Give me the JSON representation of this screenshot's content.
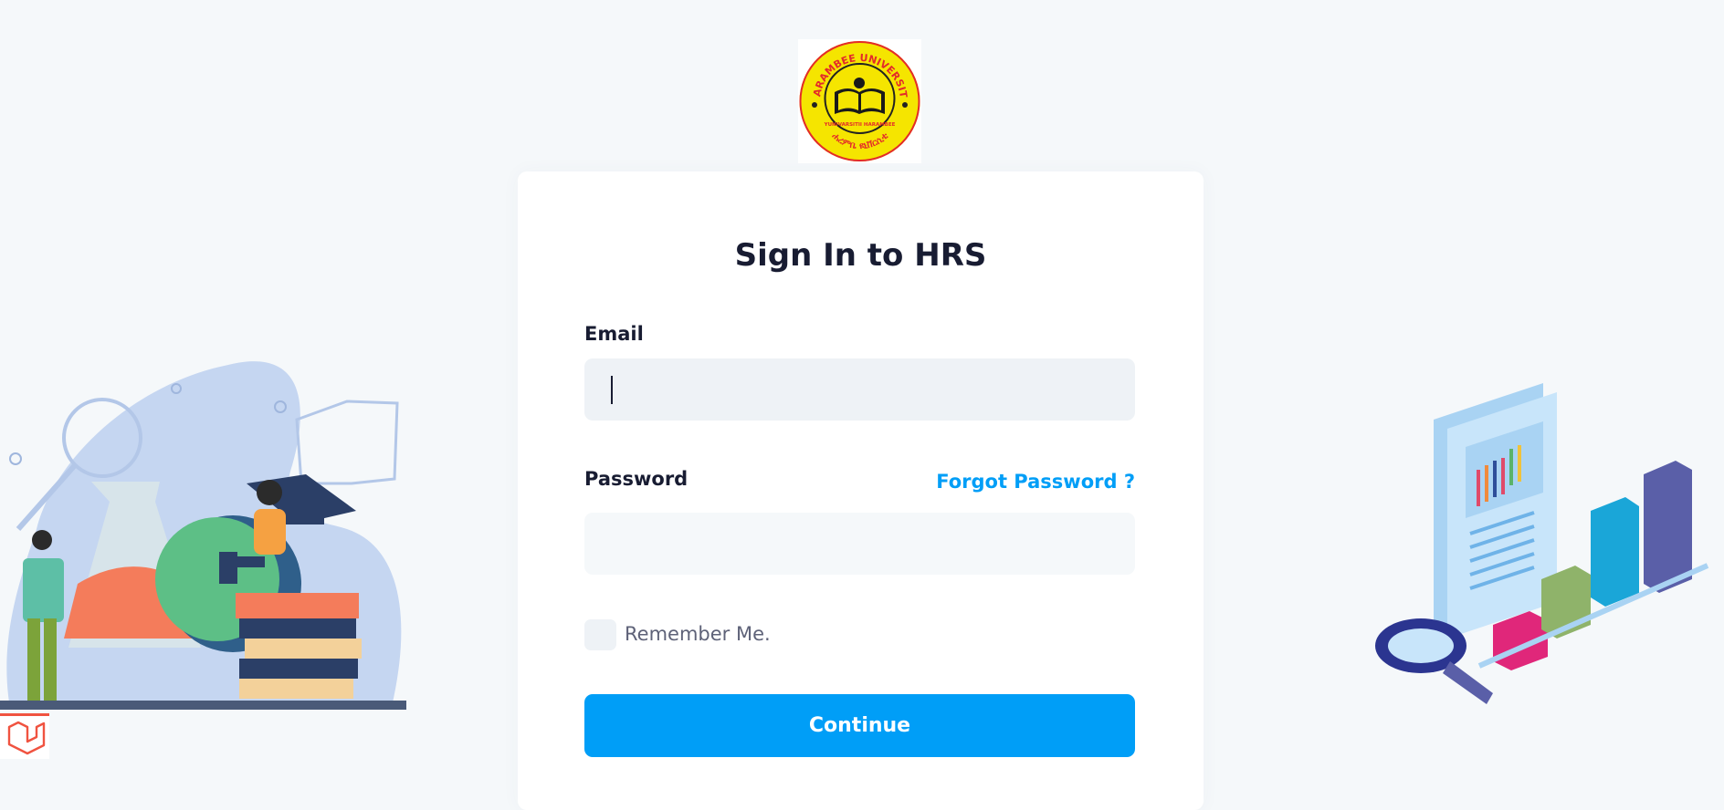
{
  "logo": {
    "top_text": "HARAMBEE UNIVERSITY",
    "middle_text": "YUNIVARSITII HARAMBEE",
    "bottom_text": "ሐረምቤ ዩኒቨርሲቲ"
  },
  "form": {
    "title": "Sign In to HRS",
    "email_label": "Email",
    "email_value": "",
    "password_label": "Password",
    "password_value": "",
    "forgot_link": "Forgot Password ?",
    "remember_label": "Remember Me.",
    "remember_checked": false,
    "submit_label": "Continue"
  },
  "colors": {
    "primary": "#009ef7",
    "heading": "#181c32",
    "muted": "#5e6278",
    "background": "#f5f8fa",
    "input_bg": "#eef2f6"
  },
  "icons": [
    "university-logo",
    "laravel-icon"
  ]
}
